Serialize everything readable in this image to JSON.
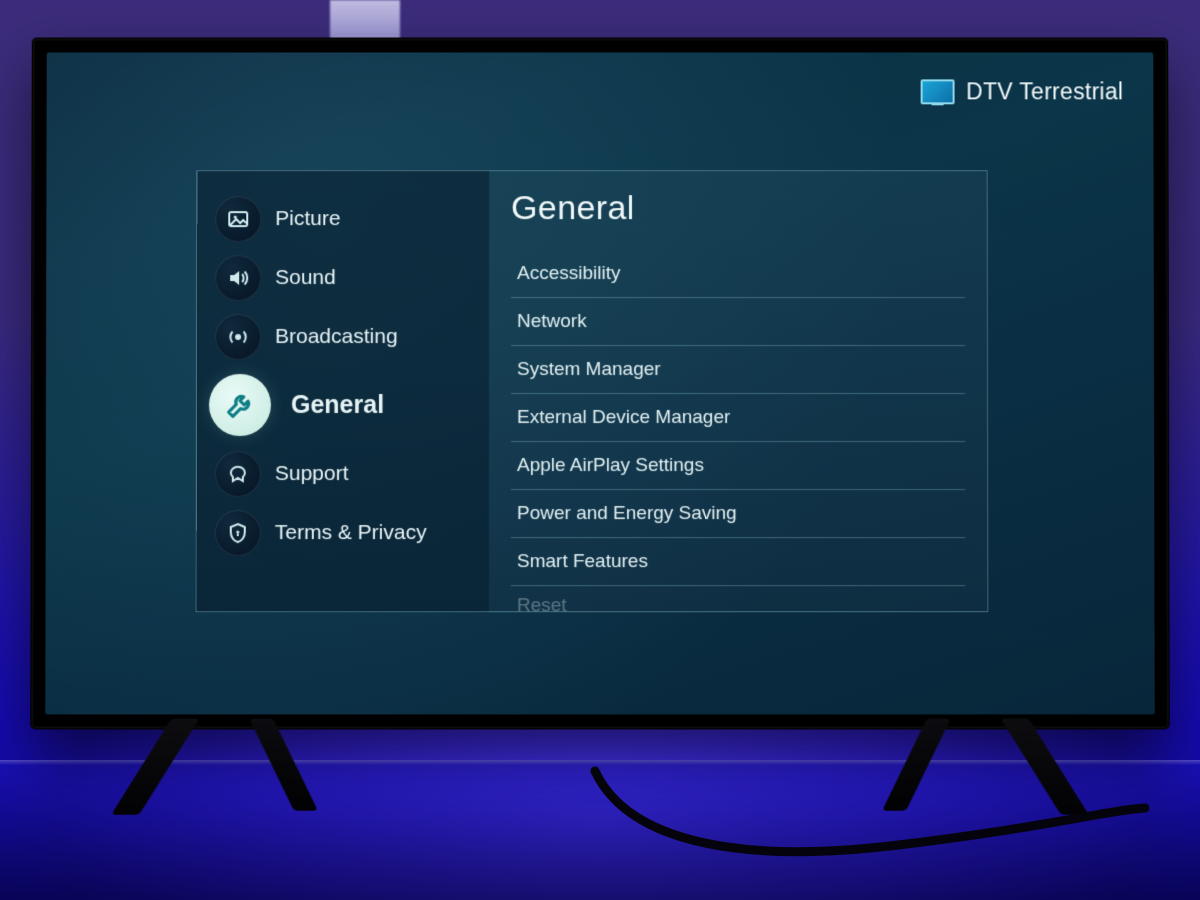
{
  "status": {
    "source_label": "DTV Terrestrial"
  },
  "sidebar": {
    "items": [
      {
        "label": "Picture",
        "selected": false
      },
      {
        "label": "Sound",
        "selected": false
      },
      {
        "label": "Broadcasting",
        "selected": false
      },
      {
        "label": "General",
        "selected": true
      },
      {
        "label": "Support",
        "selected": false
      },
      {
        "label": "Terms & Privacy",
        "selected": false
      }
    ]
  },
  "detail": {
    "title": "General",
    "options": [
      {
        "label": "Accessibility"
      },
      {
        "label": "Network"
      },
      {
        "label": "System Manager"
      },
      {
        "label": "External Device Manager"
      },
      {
        "label": "Apple AirPlay Settings"
      },
      {
        "label": "Power and Energy Saving"
      },
      {
        "label": "Smart Features"
      },
      {
        "label": "Reset",
        "fade": true
      }
    ]
  }
}
